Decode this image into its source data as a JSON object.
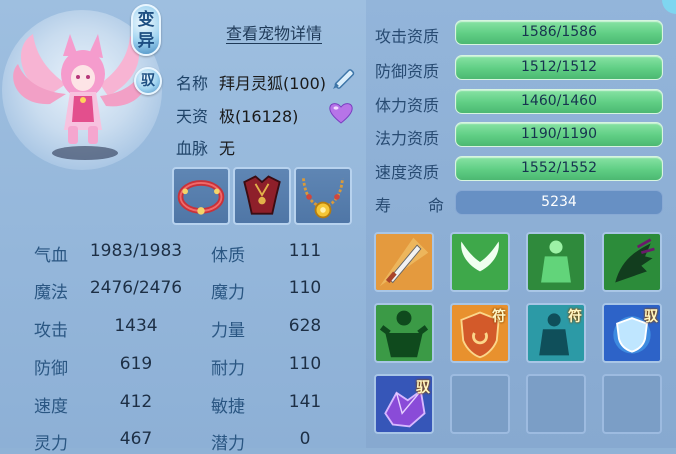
{
  "header": {
    "transform_label_1": "变",
    "transform_label_2": "异",
    "domesticate_label": "驭",
    "detail_link": "查看宠物详情"
  },
  "pet_info": {
    "name_label": "名称",
    "name_value": "拜月灵狐(100)",
    "talent_label": "天资",
    "talent_value": "极(16128)",
    "bloodline_label": "血脉",
    "bloodline_value": "无"
  },
  "equipment": [
    {
      "name": "collar-icon"
    },
    {
      "name": "armor-icon"
    },
    {
      "name": "necklace-icon"
    }
  ],
  "stats": [
    {
      "label": "气血",
      "value": "1983/1983",
      "label2": "体质",
      "value2": "111"
    },
    {
      "label": "魔法",
      "value": "2476/2476",
      "label2": "魔力",
      "value2": "110"
    },
    {
      "label": "攻击",
      "value": "1434",
      "label2": "力量",
      "value2": "628"
    },
    {
      "label": "防御",
      "value": "619",
      "label2": "耐力",
      "value2": "110"
    },
    {
      "label": "速度",
      "value": "412",
      "label2": "敏捷",
      "value2": "141"
    },
    {
      "label": "灵力",
      "value": "467",
      "label2": "潜力",
      "value2": "0"
    }
  ],
  "aptitudes": [
    {
      "label": "攻击资质",
      "value": "1586/1586"
    },
    {
      "label": "防御资质",
      "value": "1512/1512"
    },
    {
      "label": "体力资质",
      "value": "1460/1460"
    },
    {
      "label": "法力资质",
      "value": "1190/1190"
    },
    {
      "label": "速度资质",
      "value": "1552/1552"
    }
  ],
  "lifespan": {
    "label_1": "寿",
    "label_2": "命",
    "value": "5234"
  },
  "skills": [
    {
      "name": "sword-strike-skill-icon",
      "badge": ""
    },
    {
      "name": "wings-skill-icon",
      "badge": ""
    },
    {
      "name": "green-body-skill-icon",
      "badge": ""
    },
    {
      "name": "dark-claw-skill-icon",
      "badge": ""
    },
    {
      "name": "giant-strength-skill-icon",
      "badge": ""
    },
    {
      "name": "shield-rune-skill-icon",
      "badge": "符"
    },
    {
      "name": "spirit-body-skill-icon",
      "badge": "符"
    },
    {
      "name": "guard-shield-skill-icon",
      "badge": "驭"
    },
    {
      "name": "purple-crystal-skill-icon",
      "badge": "驭"
    }
  ],
  "colors": {
    "aptitude_bar": "#5fce84",
    "lifespan_bar": "#6790c4",
    "panel_background": "#8fb2d6"
  }
}
